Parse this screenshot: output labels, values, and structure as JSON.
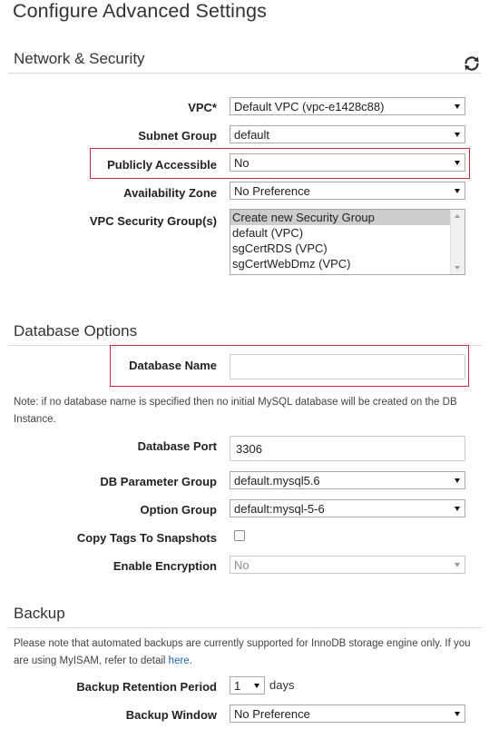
{
  "page": {
    "title": "Configure Advanced Settings"
  },
  "network_security": {
    "title": "Network & Security",
    "refresh_icon": "refresh-icon",
    "vpc": {
      "label": "VPC*",
      "value": "Default VPC (vpc-e1428c88)"
    },
    "subnet_group": {
      "label": "Subnet Group",
      "value": "default"
    },
    "publicly_accessible": {
      "label": "Publicly Accessible",
      "value": "No"
    },
    "availability_zone": {
      "label": "Availability Zone",
      "value": "No Preference"
    },
    "vpc_security_groups": {
      "label": "VPC Security Group(s)",
      "options": [
        {
          "label": "Create new Security Group",
          "selected": true
        },
        {
          "label": "default (VPC)",
          "selected": false
        },
        {
          "label": "sgCertRDS (VPC)",
          "selected": false
        },
        {
          "label": "sgCertWebDmz (VPC)",
          "selected": false
        }
      ]
    }
  },
  "database_options": {
    "title": "Database Options",
    "database_name": {
      "label": "Database Name",
      "value": ""
    },
    "note": "Note: if no database name is specified then no initial MySQL database will be created on the DB Instance.",
    "database_port": {
      "label": "Database Port",
      "value": "3306"
    },
    "db_parameter_group": {
      "label": "DB Parameter Group",
      "value": "default.mysql5.6"
    },
    "option_group": {
      "label": "Option Group",
      "value": "default:mysql-5-6"
    },
    "copy_tags": {
      "label": "Copy Tags To Snapshots",
      "checked": false
    },
    "enable_encryption": {
      "label": "Enable Encryption",
      "value": "No",
      "disabled": true
    }
  },
  "backup": {
    "title": "Backup",
    "note_text": "Please note that automated backups are currently supported for InnoDB storage engine only. If you are using MyISAM, refer to detail",
    "note_link": "here",
    "note_end": ".",
    "retention_period": {
      "label": "Backup Retention Period",
      "value": "1",
      "unit": "days"
    },
    "backup_window": {
      "label": "Backup Window",
      "value": "No Preference"
    }
  },
  "colors": {
    "highlight": "#d0253a",
    "link": "#1a64b0",
    "selected_option": "#cdcdcd"
  }
}
